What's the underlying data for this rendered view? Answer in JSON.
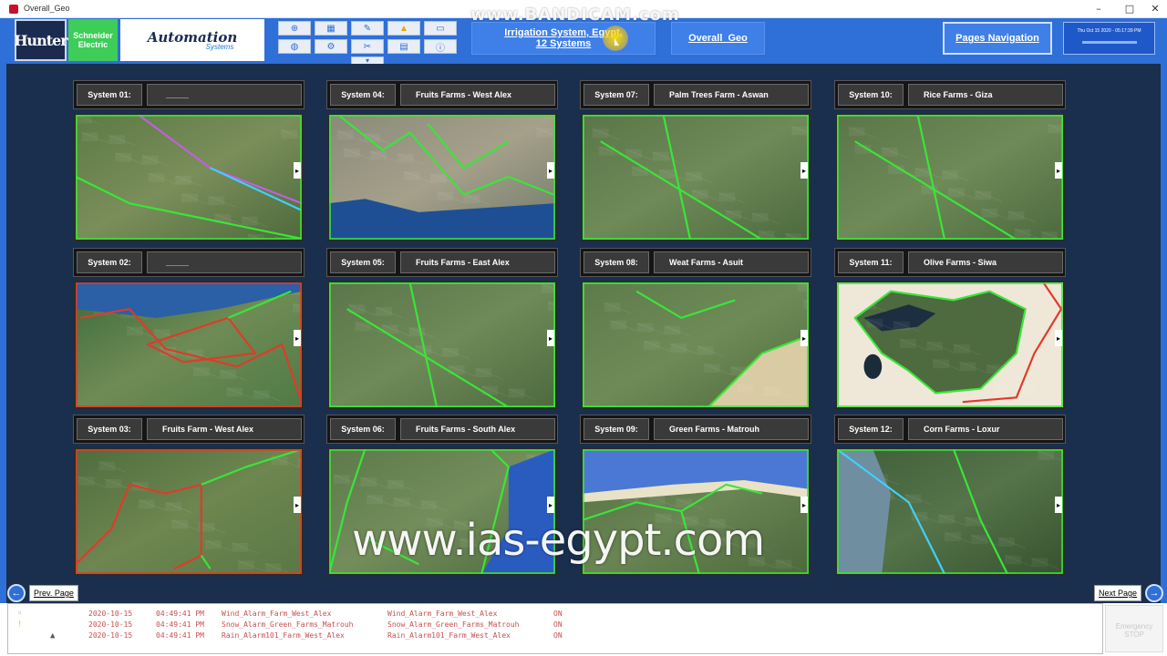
{
  "window": {
    "title": "Overall_Geo"
  },
  "header": {
    "logos": {
      "hunter": "Hunter",
      "schneider": "Schneider Electric",
      "ias_main": "Automation",
      "ias_sub": "Systems"
    },
    "irrigation_line1": "Irrigation System, Egypt,",
    "irrigation_line2": "12 Systems",
    "overall_label": "Overall_Geo",
    "pages_label": "Pages Navigation",
    "clock_text": "Thu Oct 15 2020 - 05:17:39 PM"
  },
  "toolbar_icons": [
    "network-icon",
    "building-icon",
    "wrench-icon",
    "warning-icon",
    "monitor-icon",
    "globe-icon",
    "gear-icon",
    "tools-icon",
    "chart-icon",
    "info-icon"
  ],
  "watermarks": {
    "top": "www.BANDICAM.com",
    "bottom": "www.ias-egypt.com"
  },
  "systems": [
    {
      "sys": "System 01:",
      "name": "_____",
      "theme": "farm"
    },
    {
      "sys": "System 02:",
      "name": "_____",
      "theme": "coast-red"
    },
    {
      "sys": "System 03:",
      "name": "Fruits Farm - West Alex",
      "theme": "red-green"
    },
    {
      "sys": "System 04:",
      "name": "Fruits Farms - West Alex",
      "theme": "coast-green"
    },
    {
      "sys": "System 05:",
      "name": "Fruits Farms - East Alex",
      "theme": "green"
    },
    {
      "sys": "System 06:",
      "name": "Fruits Farms - South Alex",
      "theme": "sea-right"
    },
    {
      "sys": "System 07:",
      "name": "Palm Trees Farm - Aswan",
      "theme": "green"
    },
    {
      "sys": "System 08:",
      "name": "Weat Farms - Asuit",
      "theme": "desert"
    },
    {
      "sys": "System 09:",
      "name": "Green Farms - Matrouh",
      "theme": "sea-top"
    },
    {
      "sys": "System 10:",
      "name": "Rice Farms - Giza",
      "theme": "green"
    },
    {
      "sys": "System 11:",
      "name": "Olive Farms - Siwa",
      "theme": "lake"
    },
    {
      "sys": "System 12:",
      "name": "Corn Farms - Loxur",
      "theme": "blue"
    }
  ],
  "nav": {
    "prev": "Prev. Page",
    "next": "Next Page"
  },
  "alarms": [
    {
      "date": "2020-10-15",
      "time": "04:49:41 PM",
      "tag": "Wind_Alarm_Farm_West_Alex",
      "desc": "Wind_Alarm_Farm_West_Alex",
      "state": "ON"
    },
    {
      "date": "2020-10-15",
      "time": "04:49:41 PM",
      "tag": "Snow_Alarm_Green_Farms_Matrouh",
      "desc": "Snow_Alarm_Green_Farms_Matrouh",
      "state": "ON"
    },
    {
      "date": "2020-10-15",
      "time": "04:49:41 PM",
      "tag": "Rain_Alarm101_Farm_West_Alex",
      "desc": "Rain_Alarm101_Farm_West_Alex",
      "state": "ON"
    }
  ],
  "emergency": {
    "line1": "Emergency",
    "line2": "STOP"
  },
  "colors": {
    "header": "#2e6fd8",
    "main_bg": "#1a2f4d",
    "boundary_green": "#39e639",
    "boundary_red": "#e03a2a",
    "alarm_text": "#c65050"
  }
}
